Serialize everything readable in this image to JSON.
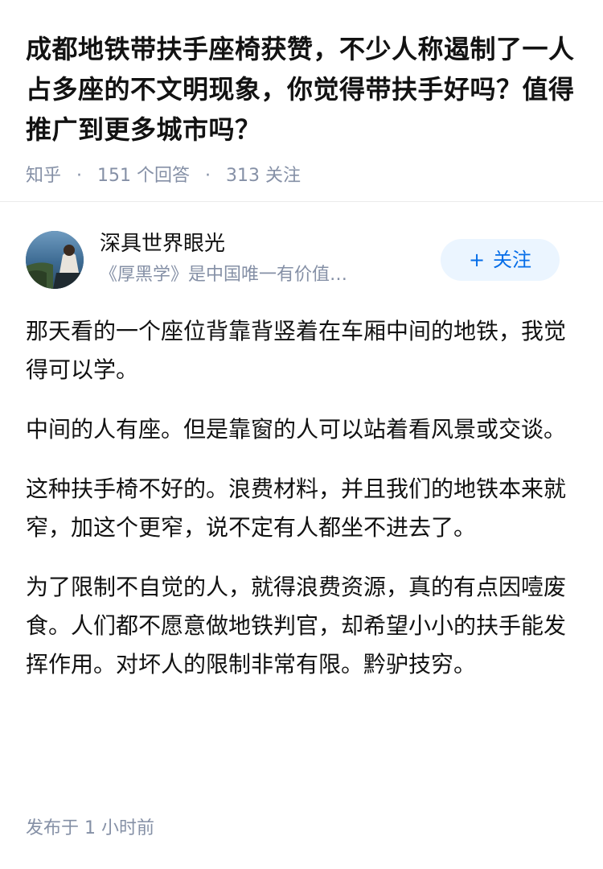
{
  "question": {
    "title": "成都地铁带扶手座椅获赞，不少人称遏制了一人占多座的不文明现象，你觉得带扶手好吗？值得推广到更多城市吗？",
    "source": "知乎",
    "answers_count": "151",
    "answers_label": "个回答",
    "followers_count": "313",
    "followers_label": "关注"
  },
  "author": {
    "name": "深具世界眼光",
    "bio": "《厚黑学》是中国唯一有价值的一…",
    "follow_label": "关注",
    "avatar_icon": "user-avatar-photo"
  },
  "answer": {
    "paragraphs": [
      "那天看的一个座位背靠背竖着在车厢中间的地铁，我觉得可以学。",
      "中间的人有座。但是靠窗的人可以站着看风景或交谈。",
      "这种扶手椅不好的。浪费材料，并且我们的地铁本来就窄，加这个更窄，说不定有人都坐不进去了。",
      "为了限制不自觉的人，就得浪费资源，真的有点因噎废食。人们都不愿意做地铁判官，却希望小小的扶手能发挥作用。对坏人的限制非常有限。黔驴技穷。"
    ],
    "publish_label": "发布于",
    "publish_time": "1 小时前"
  },
  "colors": {
    "text_primary": "#121212",
    "text_secondary": "#8590a6",
    "accent": "#056de8",
    "follow_bg": "#ebf5ff",
    "divider": "#ebebeb"
  }
}
